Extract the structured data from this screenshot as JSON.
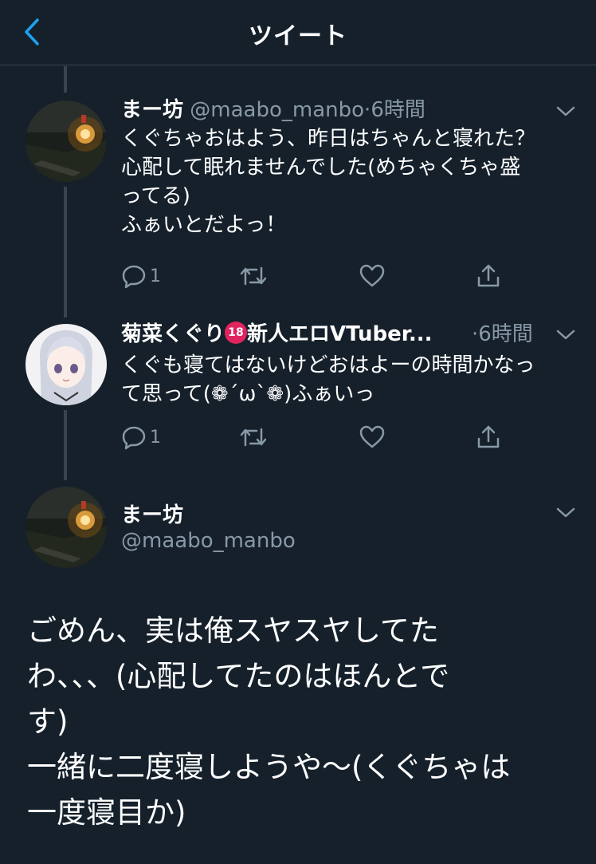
{
  "header": {
    "title": "ツイート"
  },
  "colors": {
    "background": "#15202b",
    "secondary_text": "#8899a6",
    "divider": "#38444d",
    "accent": "#1da1f2"
  },
  "tweets": [
    {
      "name": "まー坊",
      "handle": "@maabo_manbo",
      "dot": "·",
      "time": "6時間",
      "lines": [
        "くぐちゃおはよう、昨日はちゃんと寝れた？",
        "心配して眠れませんでした(めちゃくちゃ盛",
        "ってる)",
        "ふぁいとだよっ！"
      ],
      "reply_count": "1"
    },
    {
      "name": "菊菜くぐり",
      "age_badge": "18",
      "name_rest": "新人エロVTuber...",
      "dot": "·",
      "time": "6時間",
      "lines": [
        "くぐも寝てはないけどおはよーの時間かなっ",
        "て思って(❁´ω`❁)ふぁいっ"
      ],
      "reply_count": "1"
    }
  ],
  "main_tweet": {
    "name": "まー坊",
    "handle": "@maabo_manbo",
    "lines": [
      "ごめん、実は俺スヤスヤしてた",
      "わ、、、(心配してたのはほんとで",
      "す)",
      "一緒に二度寝しようや〜(くぐちゃは",
      "一度寝目か)"
    ]
  }
}
